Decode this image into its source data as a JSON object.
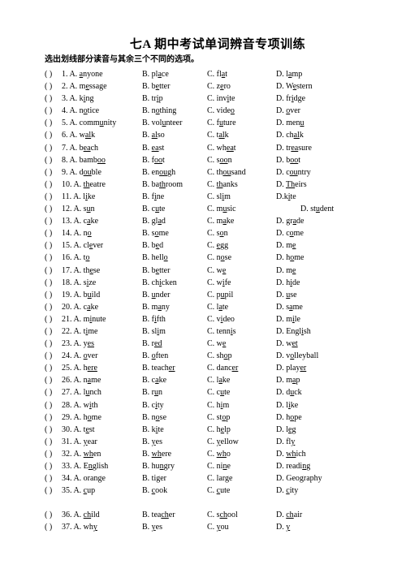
{
  "document": {
    "title": "七A 期中考试单词辨音专项训练",
    "subtitle": "选出划线部分读音与其余三个不同的选项。",
    "answer_bracket": "(        )"
  },
  "questions": [
    {
      "num": "1.",
      "a": "A. <u>a</u>nyone",
      "b": "B. pl<u>a</u>ce",
      "c": "C. fl<u>a</u>t",
      "d": "D. l<u>a</u>mp"
    },
    {
      "num": "2.",
      "a": "A. m<u>e</u>ssage",
      "b": "B. b<u>e</u>tter",
      "c": "C. z<u>e</u>ro",
      "d": "D. W<u>e</u>stern"
    },
    {
      "num": "3.",
      "a": "A. k<u>i</u>ng",
      "b": "B. tr<u>i</u>p",
      "c": "C. inv<u>i</u>te",
      "d": "D. fr<u>i</u>dge"
    },
    {
      "num": "4.",
      "a": "A. n<u>o</u>tice",
      "b": "B. n<u>o</u>thing",
      "c": "C. vide<u>o</u>",
      "d": "D. <u>o</u>ver"
    },
    {
      "num": "5.",
      "a": "A. comm<u>u</u>nity",
      "b": "B. vol<u>u</u>nteer",
      "c": "C. f<u>u</u>ture",
      "d": "D. men<u>u</u>"
    },
    {
      "num": "6.",
      "a": "A. w<u>al</u>k",
      "b": "B. <u>al</u>so",
      "c": "C. t<u>al</u>k",
      "d": "D. ch<u>al</u>k"
    },
    {
      "num": "7.",
      "a": "A. b<u>ea</u>ch",
      "b": "B. <u>ea</u>st",
      "c": "C. wh<u>ea</u>t",
      "d": "D. tr<u>ea</u>sure"
    },
    {
      "num": "8.",
      "a": "A. bamb<u>oo</u>",
      "b": "B. f<u>oo</u>t",
      "c": "C. s<u>oo</u>n",
      "d": "D. b<u>oo</u>t"
    },
    {
      "num": "9.",
      "a": "A. d<u>ou</u>ble",
      "b": "B. en<u>ou</u>gh",
      "c": "C. th<u>ou</u>sand",
      "d": "D. c<u>ou</u>ntry"
    },
    {
      "num": "10.",
      "a": "A. <u>th</u>eatre",
      "b": "B. ba<u>th</u>room",
      "c": "C. <u>th</u>anks",
      "d": "D. <u>Th</u>eirs"
    },
    {
      "num": "11.",
      "a": "A. l<u>i</u>ke",
      "b": "B. f<u>i</u>ne",
      "c": "C. sl<u>i</u>m",
      "d": "D.k<u>i</u>te"
    },
    {
      "num": "12.",
      "a": "A. s<u>u</u>n",
      "b": "B. c<u>u</u>te",
      "c": "C. m<u>u</u>sic",
      "d": "D. st<u>u</u>dent",
      "d_indent": true
    },
    {
      "num": "13.",
      "a": "A. c<u>a</u>ke",
      "b": "B. gl<u>a</u>d",
      "c": "C. m<u>a</u>ke",
      "d": "D. gr<u>a</u>de"
    },
    {
      "num": "14.",
      "a": "A. n<u>o</u>",
      "b": "B. s<u>o</u>me",
      "c": "C. s<u>o</u>n",
      "d": "D. c<u>o</u>me"
    },
    {
      "num": "15.",
      "a": "A. cl<u>e</u>ver",
      "b": "B. b<u>e</u>d",
      "c": "C. <u>e</u>gg",
      "d": "D. m<u>e</u>"
    },
    {
      "num": "16.",
      "a": "A. t<u>o</u>",
      "b": "B. hell<u>o</u>",
      "c": "C. n<u>o</u>se",
      "d": "D. h<u>o</u>me"
    },
    {
      "num": "17.",
      "a": "A. th<u>e</u>se",
      "b": "B. b<u>e</u>tter",
      "c": "C. w<u>e</u>",
      "d": "D. m<u>e</u>"
    },
    {
      "num": "18.",
      "a": "A. s<u>i</u>ze",
      "b": "B. ch<u>i</u>cken",
      "c": "C. w<u>i</u>fe",
      "d": "D. h<u>i</u>de"
    },
    {
      "num": "19.",
      "a": "A. b<u>u</u>ild",
      "b": "B. <u>u</u>nder",
      "c": "C. p<u>u</u>pil",
      "d": "D. <u>u</u>se"
    },
    {
      "num": "20.",
      "a": "A. c<u>a</u>ke",
      "b": "B. m<u>a</u>ny",
      "c": "C. l<u>a</u>te",
      "d": "D. s<u>a</u>me"
    },
    {
      "num": "21.",
      "a": "A. m<u>i</u>nute",
      "b": "B. f<u>i</u>fth",
      "c": "C. v<u>i</u>deo",
      "d": "D. m<u>i</u>le"
    },
    {
      "num": "22.",
      "a": "A. t<u>i</u>me",
      "b": "B. sl<u>i</u>m",
      "c": "C. tenn<u>i</u>s",
      "d": "D. Engl<u>i</u>sh"
    },
    {
      "num": "23.",
      "a": "A. y<u>es</u>",
      "b": "B. r<u>ed</u>",
      "c": "C. w<u>e</u>",
      "d": "D. w<u>et</u>"
    },
    {
      "num": "24.",
      "a": "A. <u>o</u>ver",
      "b": "B. <u>o</u>ften",
      "c": "C. sh<u>o</u>p",
      "d": "D. v<u>o</u>lleyball"
    },
    {
      "num": "25.",
      "a": "A. h<u>ere</u>",
      "b": "B. teach<u>er</u>",
      "c": "C. danc<u>er</u>",
      "d": "D. play<u>er</u>"
    },
    {
      "num": "26.",
      "a": "A. n<u>a</u>me",
      "b": "B. c<u>a</u>ke",
      "c": "C. l<u>a</u>ke",
      "d": "D. m<u>a</u>p"
    },
    {
      "num": "27.",
      "a": "A. l<u>u</u>nch",
      "b": "B. r<u>u</u>n",
      "c": "C. c<u>u</u>te",
      "d": "D. d<u>u</u>ck"
    },
    {
      "num": "28.",
      "a": "A. w<u>i</u>th",
      "b": "B. c<u>i</u>ty",
      "c": "C. h<u>i</u>m",
      "d": "D. l<u>i</u>ke"
    },
    {
      "num": "29.",
      "a": "A. h<u>o</u>me",
      "b": "B. n<u>o</u>se",
      "c": "C. st<u>o</u>p",
      "d": "D. h<u>o</u>pe"
    },
    {
      "num": "30.",
      "a": "A. t<u>e</u>st",
      "b": "B. k<u>i</u>te",
      "c": "C. h<u>e</u>lp",
      "d": "D. l<u>e</u>g"
    },
    {
      "num": "31.",
      "a": "A. <u>y</u>ear",
      "b": "B. <u>y</u>es",
      "c": "C. <u>y</u>ellow",
      "d": "D. fl<u>y</u>"
    },
    {
      "num": "32.",
      "a": "A. <u>wh</u>en",
      "b": "B. <u>wh</u>ere",
      "c": "C. <u>wh</u>o",
      "d": "D. <u>wh</u>ich"
    },
    {
      "num": "33.",
      "a": "A. E<u>n</u>glish",
      "b": "B. hu<u>n</u>gry",
      "c": "C. ni<u>n</u>e",
      "d": "D. readi<u>n</u>g"
    },
    {
      "num": "34.",
      "a": "A. oran<u>g</u>e",
      "b": "B. ti<u>g</u>er",
      "c": "C. lar<u>g</u>e",
      "d": "D. Geo<u>g</u>raphy"
    },
    {
      "num": "35.",
      "a": "A. <u>c</u>up",
      "b": "B. <u>c</u>ook",
      "c": "C. <u>c</u>ute",
      "d": "D. <u>c</u>ity"
    },
    {
      "num": "36.",
      "a": "A. <u>ch</u>ild",
      "b": "B. tea<u>ch</u>er",
      "c": "C. s<u>ch</u>ool",
      "d": "D. <u>ch</u>air",
      "gap_before": true
    },
    {
      "num": "37.",
      "a": "A. wh<u>y</u>",
      "b": "B. <u>y</u>es",
      "c": "C. <u>y</u>ou",
      "d": "D. <u>y</u>"
    }
  ]
}
